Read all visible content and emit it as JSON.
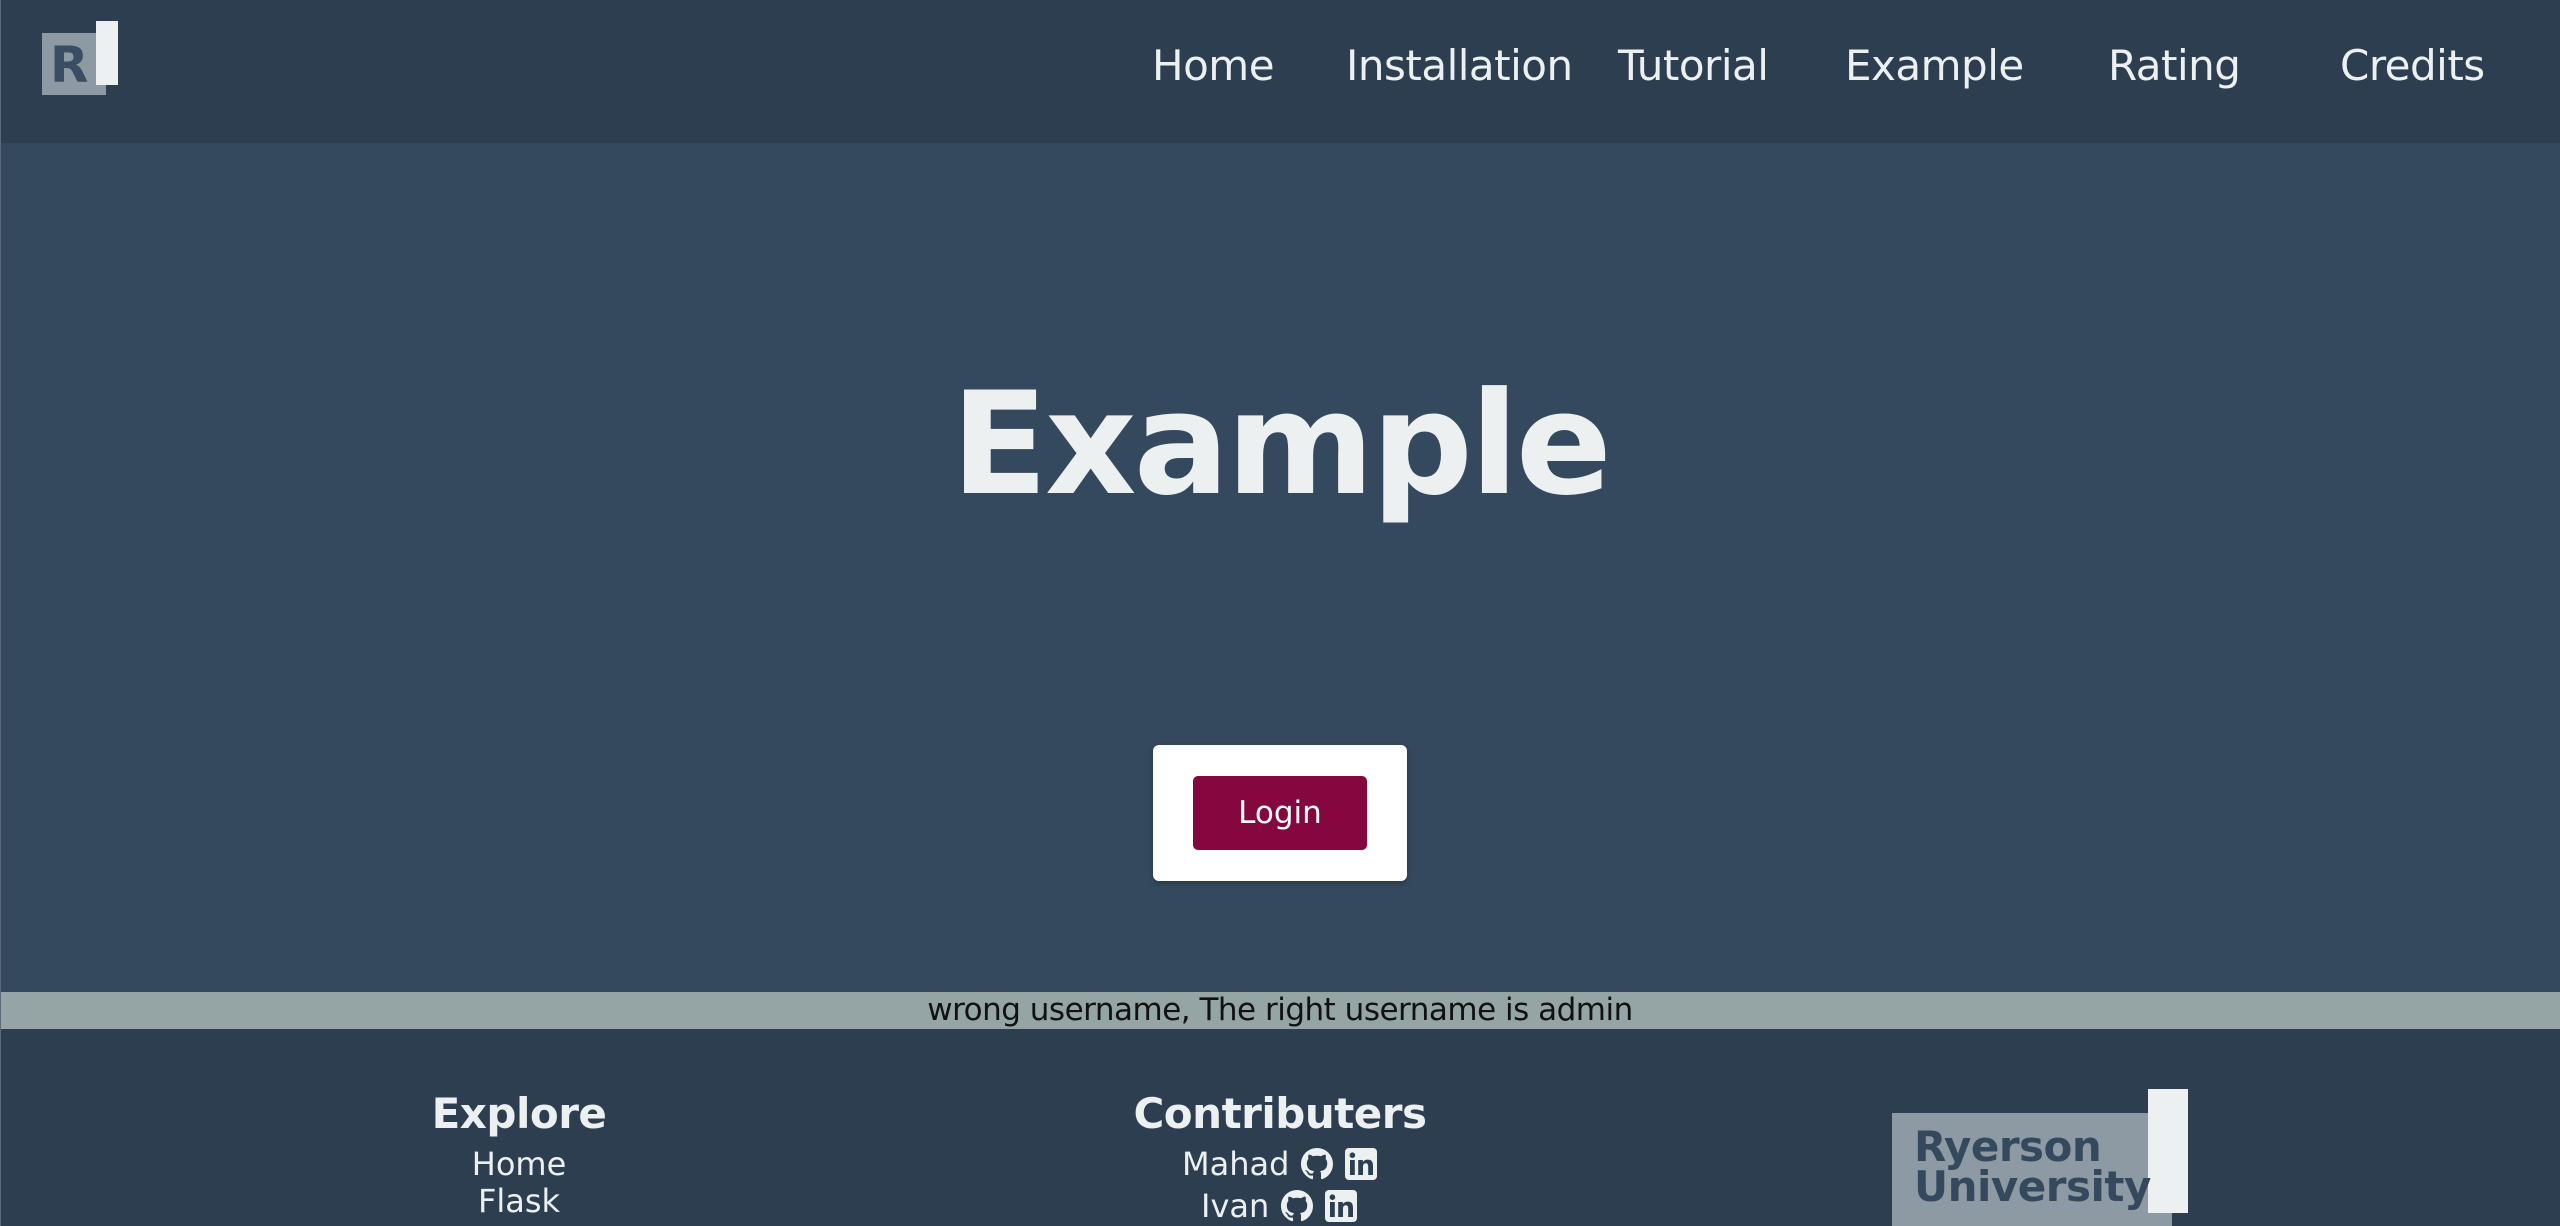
{
  "header": {
    "logo_letter": "R",
    "nav": [
      {
        "label": "Home"
      },
      {
        "label": "Installation"
      },
      {
        "label": "Tutorial"
      },
      {
        "label": "Example"
      },
      {
        "label": "Rating"
      },
      {
        "label": "Credits"
      }
    ]
  },
  "main": {
    "title": "Example",
    "login_label": "Login"
  },
  "flash": {
    "message": "wrong username, The right username is admin"
  },
  "footer": {
    "explore": {
      "heading": "Explore",
      "links": [
        "Home",
        "Flask"
      ]
    },
    "contributors": {
      "heading": "Contributers",
      "people": [
        {
          "name": "Mahad"
        },
        {
          "name": "Ivan"
        }
      ]
    },
    "university": {
      "line1": "Ryerson",
      "line2": "University"
    }
  },
  "colors": {
    "header_bg": "#2d3e51",
    "page_bg": "#34495e",
    "accent": "#85073f",
    "flash_bg": "#95a5a6",
    "text_light": "#ecf0f1"
  }
}
